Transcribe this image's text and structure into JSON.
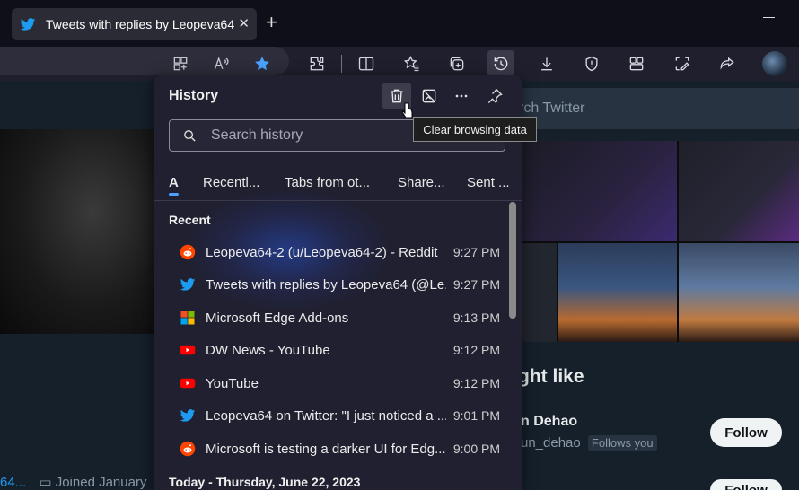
{
  "browser": {
    "tab_title": "Tweets with replies by Leopeva64",
    "tab_close": "✕",
    "new_tab": "+"
  },
  "twitter": {
    "search_placeholder": "rch Twitter",
    "left_handle": "64...",
    "left_joined": "Joined January",
    "right_title": "ght like",
    "suggest_name": "n Dehao",
    "suggest_handle": "un_dehao",
    "follows_you": "Follows you",
    "follow_label": "Follow",
    "follow_label2": "Follow"
  },
  "history": {
    "title": "History",
    "tooltip": "Clear browsing data",
    "search_placeholder": "Search history",
    "tabs": {
      "all": "A",
      "recent": "Recentl...",
      "other": "Tabs from ot...",
      "shared": "Share...",
      "sent": "Sent ..."
    },
    "section_recent": "Recent",
    "section_today": "Today - Thursday, June 22, 2023",
    "items": [
      {
        "title": "Leopeva64-2 (u/Leopeva64-2) - Reddit",
        "time": "9:27 PM",
        "icon": "reddit-icon"
      },
      {
        "title": "Tweets with replies by Leopeva64 (@Le...",
        "time": "9:27 PM",
        "icon": "twitter-icon"
      },
      {
        "title": "Microsoft Edge Add-ons",
        "time": "9:13 PM",
        "icon": "microsoft-icon"
      },
      {
        "title": "DW News - YouTube",
        "time": "9:12 PM",
        "icon": "youtube-icon"
      },
      {
        "title": "YouTube",
        "time": "9:12 PM",
        "icon": "youtube-icon"
      },
      {
        "title": "Leopeva64 on Twitter: \"I just noticed a ...",
        "time": "9:01 PM",
        "icon": "twitter-icon"
      },
      {
        "title": "Microsoft is testing a darker UI for Edg...",
        "time": "9:00 PM",
        "icon": "reddit-icon"
      }
    ]
  },
  "colors": {
    "accent": "#4aa3ff",
    "panel_bg": "#202030",
    "twitter_blue": "#1d9bf0",
    "reddit_orange": "#ff4500",
    "youtube_red": "#ff0000"
  }
}
